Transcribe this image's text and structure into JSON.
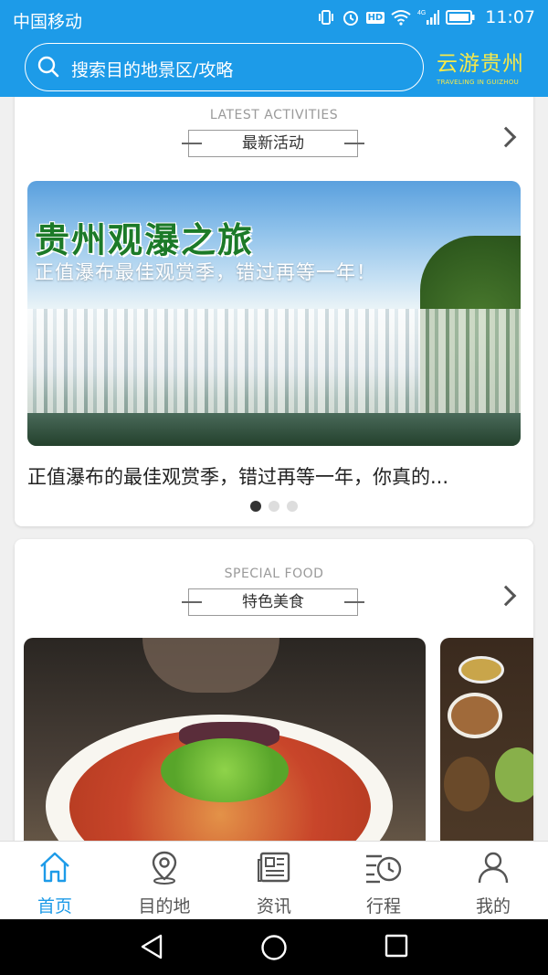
{
  "status_bar": {
    "carrier": "中国移动",
    "network": "4G",
    "hd": "HD",
    "time": "11:07"
  },
  "header": {
    "search_placeholder": "搜索目的地景区/攻略",
    "brand_cn": "云游贵州",
    "brand_en": "TRAVELING IN GUIZHOU",
    "brand_color": "#f6e94a",
    "accent_color": "#1d9be8"
  },
  "activities": {
    "section_en": "LATEST ACTIVITIES",
    "section_cn": "最新活动",
    "banner_title": "贵州观瀑之旅",
    "banner_subtitle": "正值瀑布最佳观赏季，错过再等一年！",
    "caption": "正值瀑布的最佳观赏季，错过再等一年，你真的...",
    "pager": {
      "total": 3,
      "active_index": 0
    }
  },
  "food": {
    "section_en": "SPECIAL FOOD",
    "section_cn": "特色美食"
  },
  "bottom_nav": {
    "items": [
      {
        "label": "首页",
        "icon": "home-icon",
        "active": true
      },
      {
        "label": "目的地",
        "icon": "location-pin-icon",
        "active": false
      },
      {
        "label": "资讯",
        "icon": "news-icon",
        "active": false
      },
      {
        "label": "行程",
        "icon": "itinerary-clock-icon",
        "active": false
      },
      {
        "label": "我的",
        "icon": "user-icon",
        "active": false
      }
    ]
  },
  "system_nav": {
    "buttons": [
      "back-icon",
      "home-circle-icon",
      "recents-icon"
    ]
  }
}
